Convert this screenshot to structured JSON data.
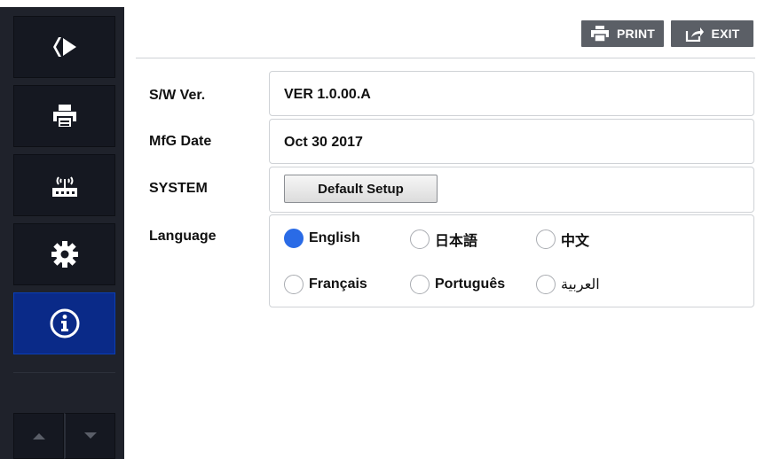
{
  "sidebar": {
    "items": [
      {
        "icon": "logo-icon"
      },
      {
        "icon": "printer-icon"
      },
      {
        "icon": "network-icon"
      },
      {
        "icon": "gear-icon"
      },
      {
        "icon": "info-icon",
        "active": true
      }
    ],
    "up_icon": "arrow-up-icon",
    "down_icon": "arrow-down-icon"
  },
  "toolbar": {
    "print_label": "PRINT",
    "exit_label": "EXIT"
  },
  "info": {
    "sw_label": "S/W Ver.",
    "sw_value": "VER 1.0.00.A",
    "mfg_label": "MfG Date",
    "mfg_value": "Oct 30 2017",
    "system_label": "SYSTEM",
    "default_setup_label": "Default Setup",
    "language_label": "Language"
  },
  "languages": {
    "selected": "English",
    "options": [
      "English",
      "日本語",
      "中文",
      "Français",
      "Português",
      "العربية"
    ]
  },
  "colors": {
    "sidebar_bg": "#1f222b",
    "active_nav": "#0a2a88",
    "accent": "#2a6be6",
    "toolbar_btn": "#5b5f66"
  }
}
